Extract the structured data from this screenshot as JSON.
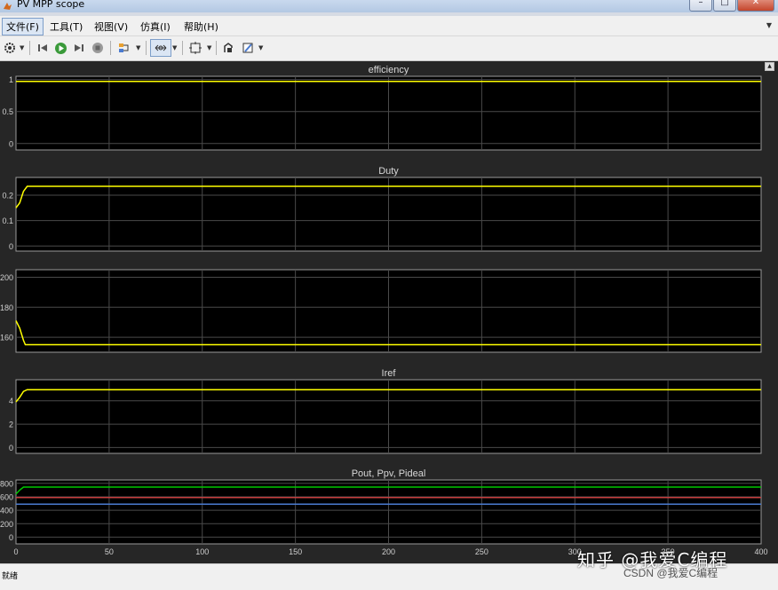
{
  "window": {
    "title": "PV MPP scope",
    "minimize_icon": "minimize-icon",
    "maximize_icon": "maximize-icon",
    "close_icon": "close-icon"
  },
  "menubar": {
    "items": [
      {
        "label": "文件(F)"
      },
      {
        "label": "工具(T)"
      },
      {
        "label": "视图(V)"
      },
      {
        "label": "仿真(I)"
      },
      {
        "label": "帮助(H)"
      }
    ]
  },
  "toolbar": {
    "icons": [
      "gear-icon",
      "step-back-icon",
      "run-icon",
      "step-forward-icon",
      "stop-icon",
      "highlight-icon",
      "zoom-icon",
      "autoscale-icon",
      "restore-icon",
      "style-icon"
    ]
  },
  "colors": {
    "plot_bg": "#000000",
    "figure_bg": "#262626",
    "grid": "#4a4a4a",
    "trace_yellow": "#ffff00",
    "trace_green": "#00c800",
    "trace_red": "#c84040",
    "trace_blue": "#4a7bd0"
  },
  "chart_data": [
    {
      "type": "line",
      "title": "efficiency",
      "xlim": [
        0,
        400
      ],
      "ylim": [
        -0.1,
        1.05
      ],
      "yticks": [
        "1",
        "0.5",
        "0"
      ],
      "ytick_values": [
        1,
        0.5,
        0
      ],
      "show_xticks": false,
      "grid": true,
      "series": [
        {
          "color": "#ffff00",
          "x": [
            0,
            400
          ],
          "y": [
            0.97,
            0.97
          ]
        }
      ]
    },
    {
      "type": "line",
      "title": "Duty",
      "xlim": [
        0,
        400
      ],
      "ylim": [
        -0.02,
        0.27
      ],
      "yticks": [
        "0.2",
        "0.1",
        "0"
      ],
      "ytick_values": [
        0.2,
        0.1,
        0
      ],
      "show_xticks": false,
      "grid": true,
      "series": [
        {
          "color": "#ffff00",
          "x": [
            0,
            2,
            4,
            6,
            400
          ],
          "y": [
            0.15,
            0.17,
            0.215,
            0.235,
            0.235
          ]
        }
      ]
    },
    {
      "type": "line",
      "title": "",
      "xlim": [
        0,
        400
      ],
      "ylim": [
        150,
        205
      ],
      "yticks": [
        "200",
        "180",
        "160"
      ],
      "ytick_values": [
        200,
        180,
        160
      ],
      "show_xticks": false,
      "grid": true,
      "series": [
        {
          "color": "#ffff00",
          "x": [
            0,
            2,
            4,
            5,
            400
          ],
          "y": [
            171,
            166,
            158,
            155,
            155
          ]
        }
      ]
    },
    {
      "type": "line",
      "title": "Iref",
      "xlim": [
        0,
        400
      ],
      "ylim": [
        -0.5,
        5.8
      ],
      "yticks": [
        "4",
        "2",
        "0"
      ],
      "ytick_values": [
        4,
        2,
        0
      ],
      "show_xticks": false,
      "grid": true,
      "series": [
        {
          "color": "#ffff00",
          "x": [
            0,
            2,
            4,
            6,
            400
          ],
          "y": [
            3.9,
            4.3,
            4.8,
            4.95,
            4.95
          ]
        }
      ]
    },
    {
      "type": "line",
      "title": "Pout, Ppv, Pideal",
      "xlim": [
        0,
        400
      ],
      "ylim": [
        -100,
        850
      ],
      "yticks": [
        "800",
        "600",
        "400",
        "200",
        "0"
      ],
      "ytick_values": [
        800,
        600,
        400,
        200,
        0
      ],
      "xticks": [
        "0",
        "50",
        "100",
        "150",
        "200",
        "250",
        "300",
        "350",
        "400"
      ],
      "xtick_values": [
        0,
        50,
        100,
        150,
        200,
        250,
        300,
        350,
        400
      ],
      "show_xticks": true,
      "grid": true,
      "series": [
        {
          "color": "#00c800",
          "x": [
            0,
            2,
            4,
            400
          ],
          "y": [
            640,
            700,
            745,
            745
          ]
        },
        {
          "color": "#c84040",
          "x": [
            0,
            400
          ],
          "y": [
            590,
            590
          ]
        },
        {
          "color": "#4a7bd0",
          "x": [
            0,
            400
          ],
          "y": [
            490,
            490
          ]
        }
      ]
    }
  ],
  "statusbar": {
    "text": "就绪"
  },
  "watermark": {
    "main": "知乎 @我爱C编程",
    "sub": "CSDN @我爱C编程"
  }
}
